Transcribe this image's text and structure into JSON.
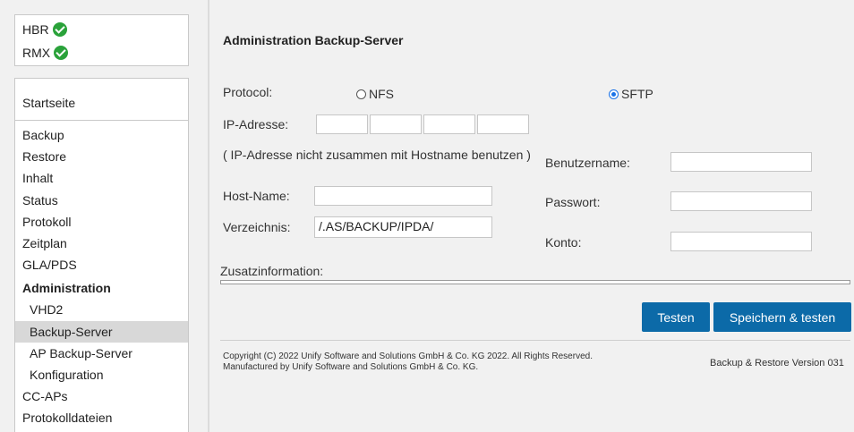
{
  "status": [
    {
      "label": "HBR",
      "icon": "check-circle-icon"
    },
    {
      "label": "RMX",
      "icon": "check-circle-icon"
    }
  ],
  "nav": {
    "home": "Startseite",
    "items": [
      {
        "label": "Backup"
      },
      {
        "label": "Restore"
      },
      {
        "label": "Inhalt"
      },
      {
        "label": "Status"
      },
      {
        "label": "Protokoll"
      },
      {
        "label": "Zeitplan"
      },
      {
        "label": "GLA/PDS"
      },
      {
        "label": "Administration"
      },
      {
        "label": "VHD2"
      },
      {
        "label": "Backup-Server"
      },
      {
        "label": "AP Backup-Server"
      },
      {
        "label": "Konfiguration"
      },
      {
        "label": "CC-APs"
      },
      {
        "label": "Protokolldateien"
      }
    ]
  },
  "main": {
    "title": "Administration Backup-Server",
    "protocol_label": "Protocol:",
    "protocol_options": [
      {
        "label": "NFS",
        "selected": false
      },
      {
        "label": "SFTP",
        "selected": true
      }
    ],
    "ip_label": "IP-Adresse:",
    "ip_octets": [
      "",
      "",
      "",
      ""
    ],
    "ip_hint": "( IP-Adresse nicht zusammen mit Hostname benutzen )",
    "host_label": "Host-Name:",
    "host_value": "",
    "dir_label": "Verzeichnis:",
    "dir_value": "/.AS/BACKUP/IPDA/",
    "user_label": "Benutzername:",
    "user_value": "",
    "pass_label": "Passwort:",
    "pass_value": "",
    "account_label": "Konto:",
    "account_value": "",
    "extra_label": "Zusatzinformation:",
    "test_button": "Testen",
    "save_test_button": "Speichern & testen"
  },
  "footer": {
    "copyright_line1": "Copyright (C) 2022 Unify Software and Solutions GmbH & Co. KG 2022. All Rights Reserved.",
    "copyright_line2": "Manufactured by Unify Software and Solutions GmbH & Co. KG.",
    "version": "Backup & Restore Version 031"
  },
  "colors": {
    "accent": "#0c6aa8",
    "ok": "#2aa23a",
    "radio": "#1a73e8"
  }
}
